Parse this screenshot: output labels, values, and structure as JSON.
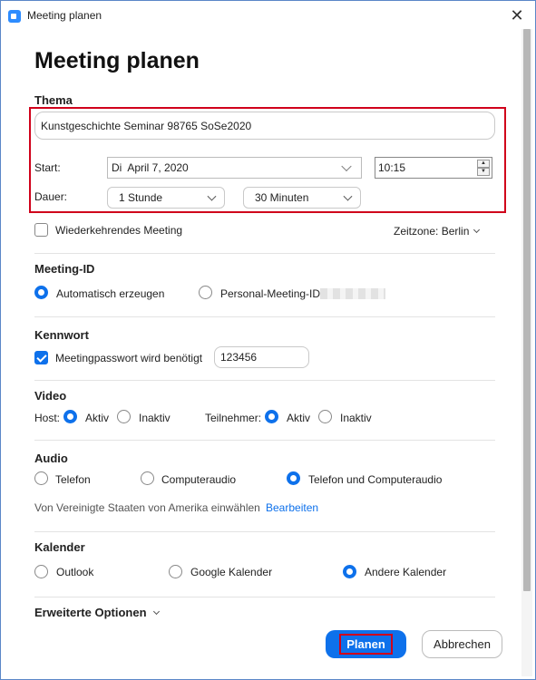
{
  "window": {
    "title": "Meeting planen"
  },
  "page": {
    "heading": "Meeting planen"
  },
  "topic": {
    "label": "Thema",
    "value": "Kunstgeschichte Seminar 98765 SoSe2020"
  },
  "start": {
    "label": "Start:",
    "day": "Di",
    "date": "April 7, 2020",
    "time": "10:15"
  },
  "duration": {
    "label": "Dauer:",
    "hours": "1 Stunde",
    "minutes": "30 Minuten"
  },
  "recurring": {
    "label": "Wiederkehrendes Meeting",
    "checked": false
  },
  "timezone": {
    "label": "Zeitzone: Berlin"
  },
  "meeting_id": {
    "heading": "Meeting-ID",
    "options": [
      "Automatisch erzeugen",
      "Personal-Meeting-ID"
    ],
    "selected": "Automatisch erzeugen"
  },
  "password": {
    "heading": "Kennwort",
    "checkbox_label": "Meetingpasswort wird benötigt",
    "checked": true,
    "value": "123456"
  },
  "video": {
    "heading": "Video",
    "host_label": "Host:",
    "participants_label": "Teilnehmer:",
    "on": "Aktiv",
    "off": "Inaktiv",
    "host": "Aktiv",
    "participants": "Aktiv"
  },
  "audio": {
    "heading": "Audio",
    "options": [
      "Telefon",
      "Computeraudio",
      "Telefon und Computeraudio"
    ],
    "selected": "Telefon und Computeraudio",
    "dial_in_text": "Von Vereinigte Staaten von Amerika einwählen",
    "edit_link": "Bearbeiten"
  },
  "calendar": {
    "heading": "Kalender",
    "options": [
      "Outlook",
      "Google Kalender",
      "Andere Kalender"
    ],
    "selected": "Andere Kalender"
  },
  "advanced": {
    "label": "Erweiterte Optionen"
  },
  "buttons": {
    "schedule": "Planen",
    "cancel": "Abbrechen"
  },
  "colors": {
    "accent": "#0e71eb",
    "highlight": "#d0021b"
  },
  "icons": {
    "app": "zoom-camera-icon",
    "close": "close-icon",
    "chevron": "chevron-down-icon"
  }
}
